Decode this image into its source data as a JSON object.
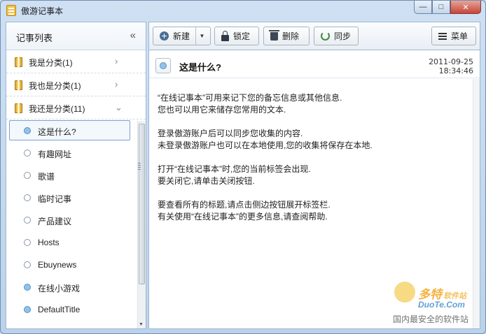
{
  "window": {
    "title": "傲游记事本",
    "minimize_glyph": "—",
    "maximize_glyph": "□",
    "close_glyph": "✕"
  },
  "sidebar": {
    "title": "记事列表",
    "collapse_glyph": "«",
    "categories": [
      {
        "label": "我是分类(1)",
        "arrow": "›",
        "icon": "folder-icon"
      },
      {
        "label": "我也是分类(1)",
        "arrow": "›",
        "icon": "folder-icon"
      },
      {
        "label": "我还是分类(11)",
        "arrow": "⌄",
        "icon": "folder-icon"
      }
    ],
    "notes": [
      {
        "label": "这是什么?",
        "dot": "blue",
        "selected": true
      },
      {
        "label": "有趣网址",
        "dot": "white"
      },
      {
        "label": "歌谱",
        "dot": "white"
      },
      {
        "label": "临时记事",
        "dot": "white"
      },
      {
        "label": "产品建议",
        "dot": "white"
      },
      {
        "label": "Hosts",
        "dot": "white"
      },
      {
        "label": "Ebuynews",
        "dot": "white"
      },
      {
        "label": "在线小游戏",
        "dot": "blue"
      },
      {
        "label": "DefaultTitle",
        "dot": "blue"
      }
    ]
  },
  "toolbar": {
    "new_label": "新建",
    "new_dropdown_glyph": "▼",
    "lock_label": "锁定",
    "delete_label": "删除",
    "sync_label": "同步",
    "menu_label": "菜单"
  },
  "note": {
    "title": "这是什么?",
    "date": "2011-09-25",
    "time": "18:34:46",
    "paragraphs": [
      [
        "“在线记事本”可用来记下您的备忘信息或其他信息.",
        "您也可以用它来储存您常用的文本."
      ],
      [
        "登录傲游账户后可以同步您收集的内容.",
        "未登录傲游账户也可以在本地使用,您的收集将保存在本地."
      ],
      [
        "打开“在线记事本”时,您的当前标签会出现.",
        "要关闭它,请单击关闭按钮."
      ],
      [
        "要查看所有的标题,请点击侧边按钮展开标签栏.",
        "有关使用“在线记事本”的更多信息,请查阅帮助."
      ]
    ]
  },
  "watermark": {
    "brand": "多特",
    "brand_suffix": "软件站",
    "url": "DuoTe.Com",
    "slogan": "国内最安全的软件站"
  },
  "colors": {
    "accent": "#7da2ce",
    "dot_blue": "#8fc3ee",
    "folder": "#e7b640",
    "close": "#c6453a"
  }
}
